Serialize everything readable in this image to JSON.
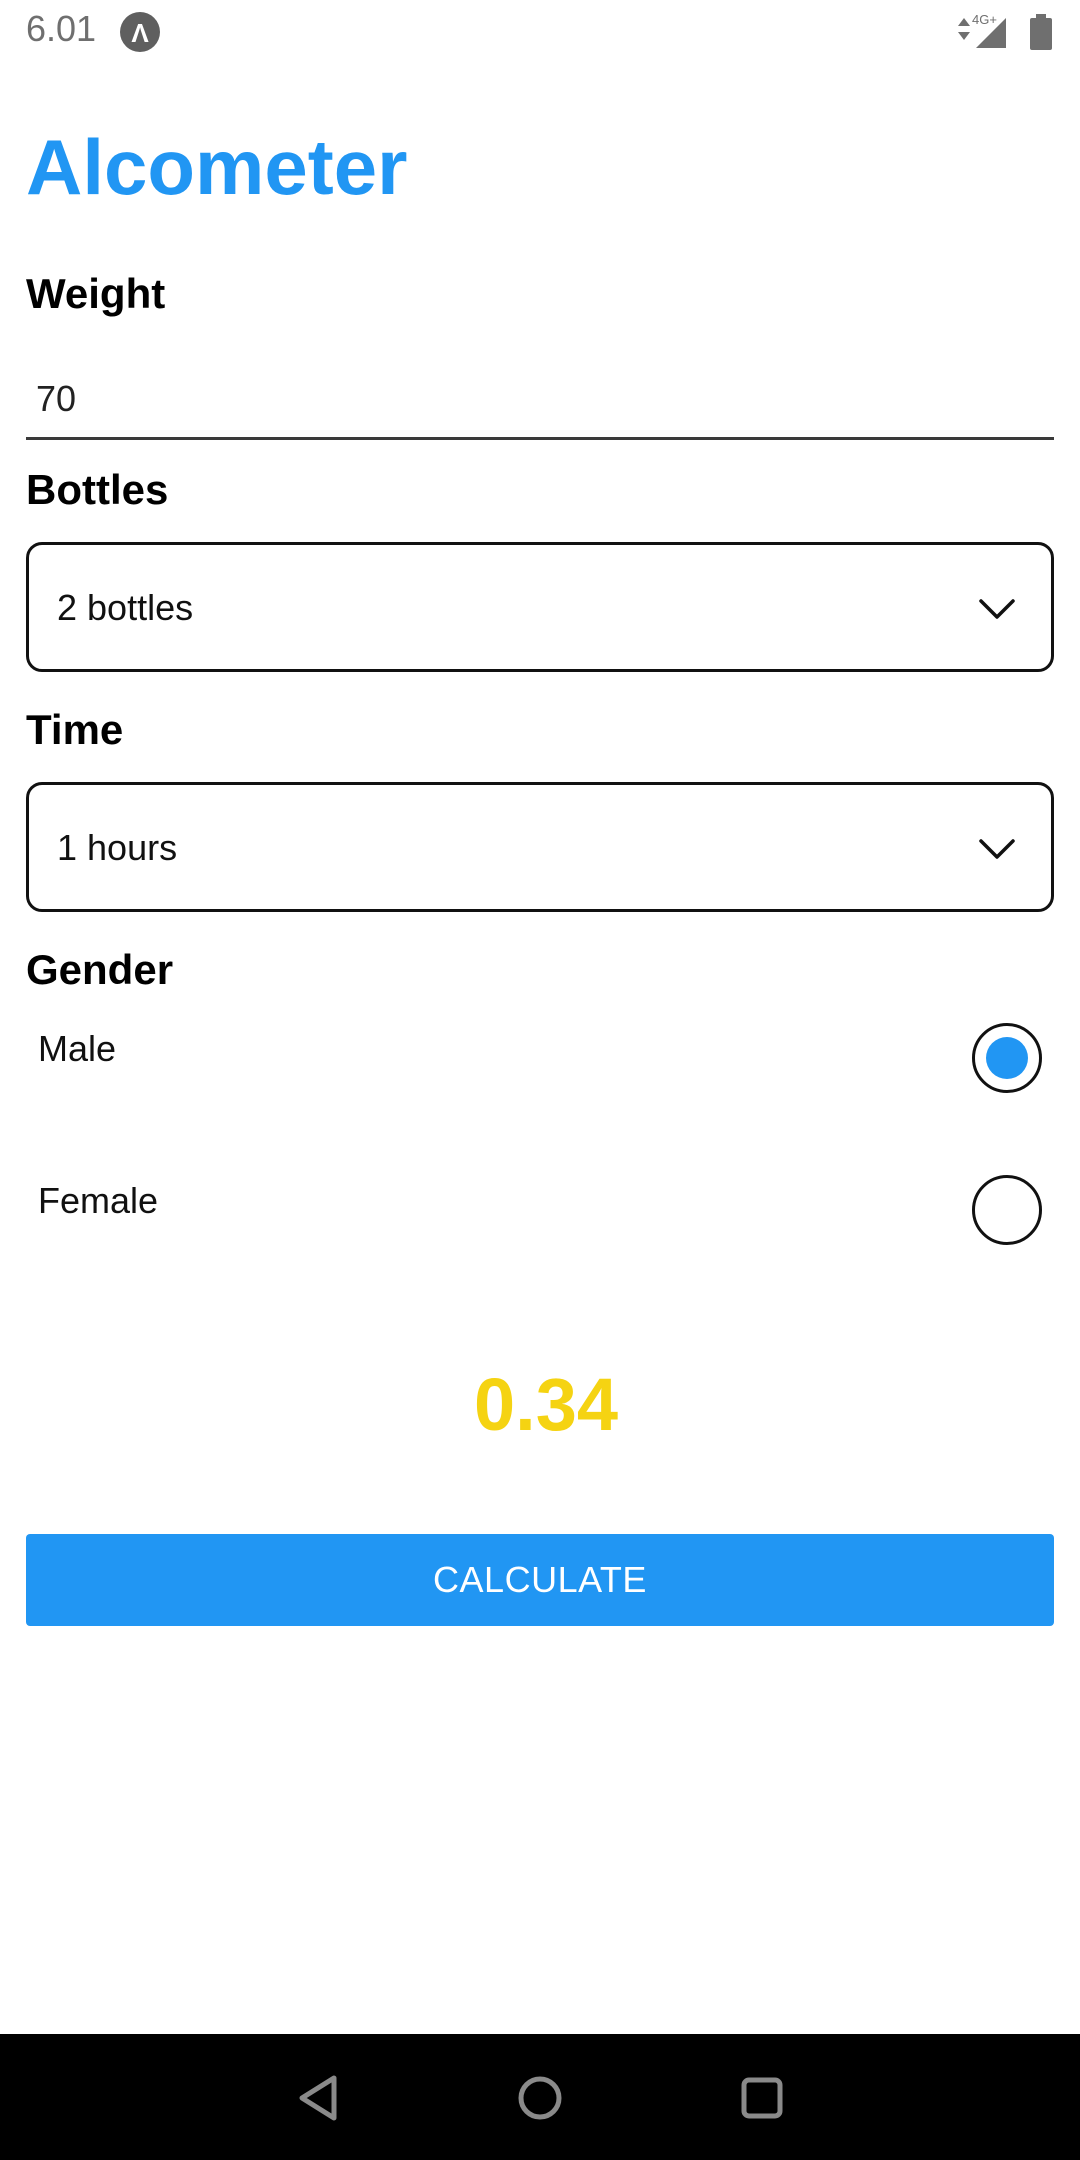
{
  "status_bar": {
    "time": "6.01",
    "app_badge": "Λ",
    "network": "4G+"
  },
  "app": {
    "title": "Alcometer"
  },
  "weight": {
    "label": "Weight",
    "value": "70"
  },
  "bottles": {
    "label": "Bottles",
    "selected": "2 bottles"
  },
  "time": {
    "label": "Time",
    "selected": "1 hours"
  },
  "gender": {
    "label": "Gender",
    "options": [
      {
        "label": "Male",
        "selected": true
      },
      {
        "label": "Female",
        "selected": false
      }
    ]
  },
  "result": {
    "value": "0.34",
    "color": "#f5d312"
  },
  "actions": {
    "calculate_label": "CALCULATE"
  },
  "colors": {
    "accent": "#2196f3",
    "result": "#f5d312",
    "nav_bar": "#000000"
  },
  "icons": {
    "bottles_chevron": "chevron-down-icon",
    "time_chevron": "chevron-down-icon",
    "nav_back": "back-triangle-icon",
    "nav_home": "home-circle-icon",
    "nav_recents": "recents-square-icon"
  }
}
